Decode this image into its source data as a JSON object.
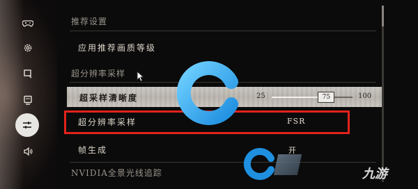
{
  "sidebar": {
    "icons": [
      "gamepad-icon",
      "gear-icon",
      "display-icon",
      "monitor-icon",
      "sliders-icon",
      "speaker-icon"
    ],
    "active_index": 4
  },
  "settings": {
    "section_recommend": "推荐设置",
    "apply_recommend": "应用推荐画质等级",
    "section_super_res": "超分辨率采样",
    "sharpness_label": "超采样清晰度",
    "sharpness_min": "25",
    "sharpness_max": "100",
    "sharpness_value": "75",
    "super_res_label": "超分辨率采样",
    "super_res_value": "FSR",
    "frame_gen_label": "帧生成",
    "frame_gen_value": "开",
    "section_nvidia": "NVIDIA全景光线追踪"
  },
  "watermark": {
    "brand_text": "九游"
  },
  "colors": {
    "highlight": "#e3221c",
    "logo_blue": "#1f8fe0"
  }
}
